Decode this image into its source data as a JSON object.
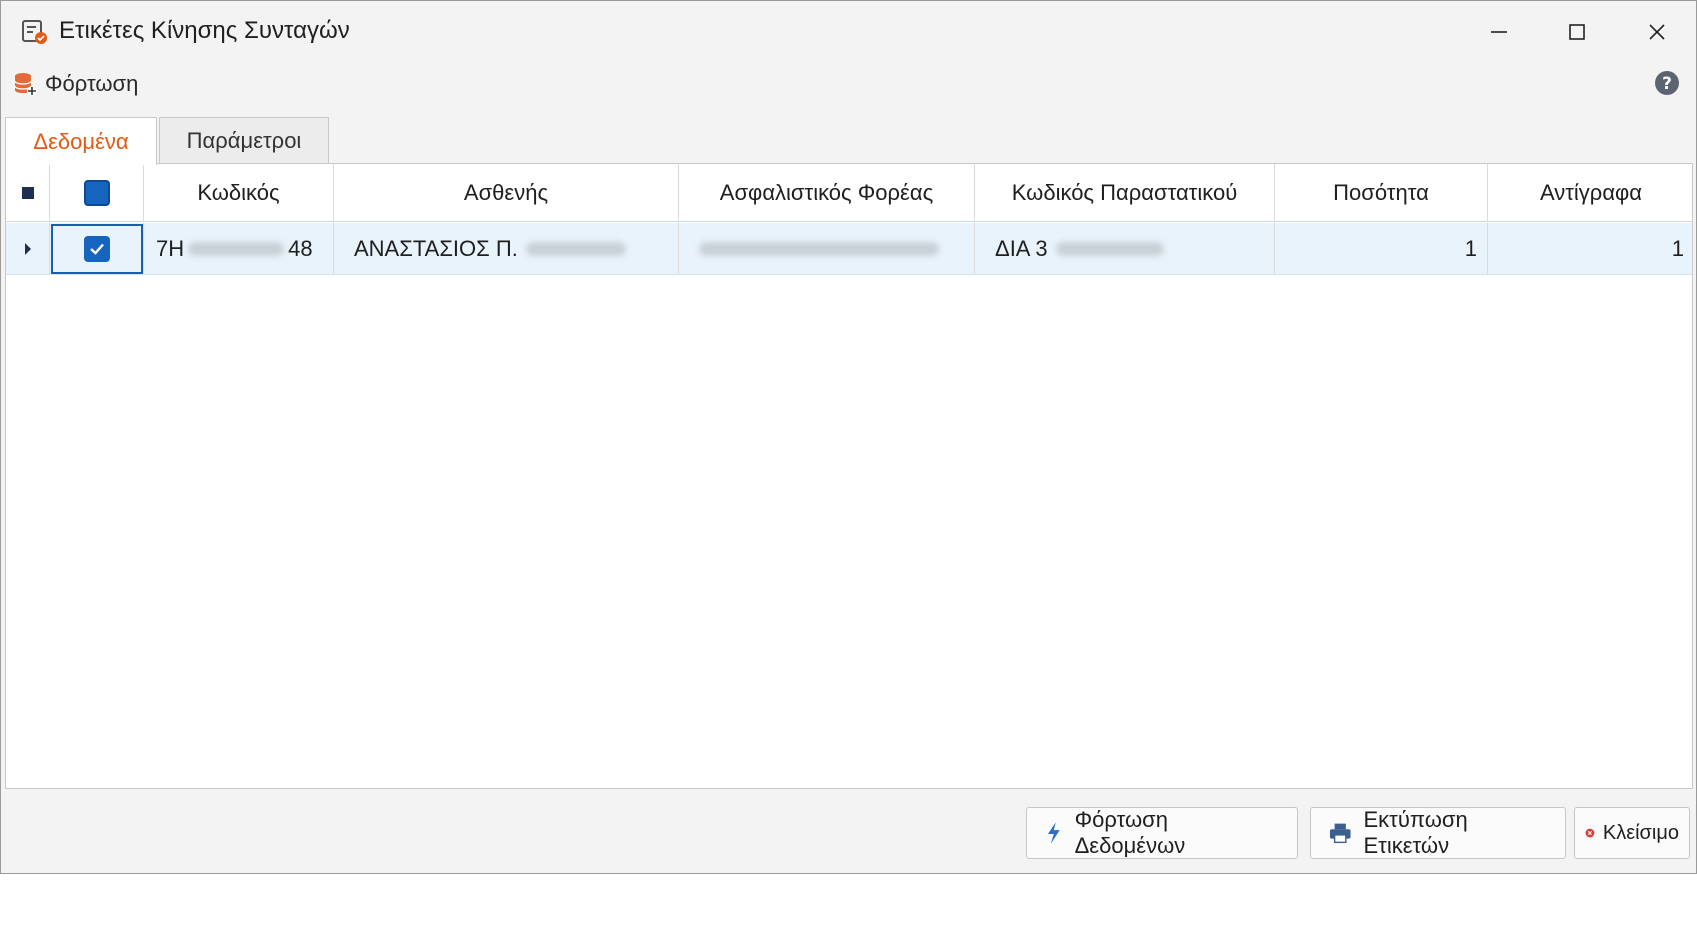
{
  "window": {
    "title": "Ετικέτες Κίνησης Συνταγών"
  },
  "menu": {
    "load_label": "Φόρτωση"
  },
  "tabs": [
    {
      "label": "Δεδομένα",
      "active": true
    },
    {
      "label": "Παράμετροι",
      "active": false
    }
  ],
  "grid": {
    "columns": [
      "Κωδικός",
      "Ασθενής",
      "Ασφαλιστικός Φορέας",
      "Κωδικός Παραστατικού",
      "Ποσότητα",
      "Αντίγραφα"
    ],
    "rows": [
      {
        "checked": true,
        "code_start": "7H",
        "code_end": "48",
        "patient": "ΑΝΑΣΤΑΣΙΟΣ Π.",
        "insurer": "",
        "doc_code": "ΔΙΑ 3",
        "quantity": "1",
        "copies": "1"
      }
    ]
  },
  "buttons": {
    "load_data": "Φόρτωση Δεδομένων",
    "print_labels": "Εκτύπωση Ετικετών",
    "close": "Κλείσιμο"
  },
  "colors": {
    "accent_tab": "#e35a14",
    "checkbox": "#1565c0",
    "row_selected": "#e9f3fc",
    "close_icon": "#d9423a"
  }
}
